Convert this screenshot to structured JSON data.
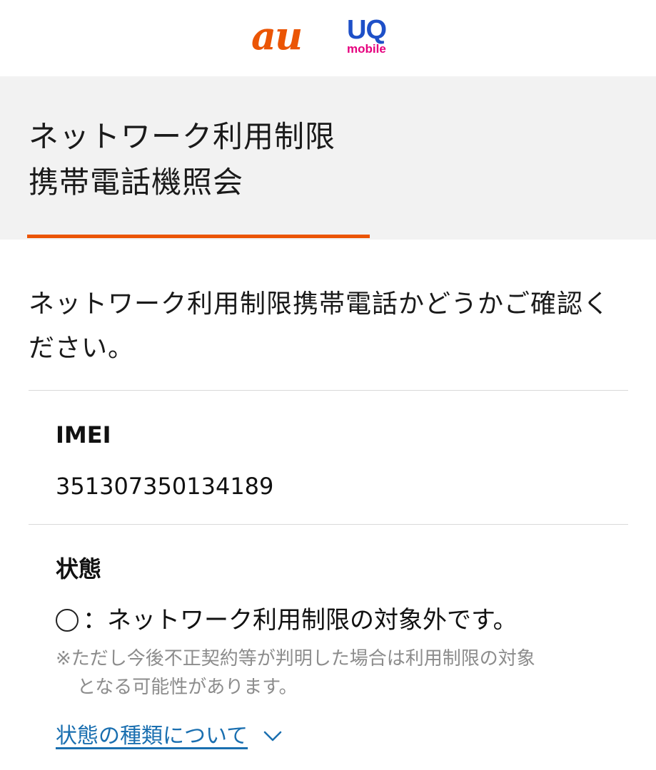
{
  "header": {
    "au_logo_text": "au",
    "uq_logo_text": "UQ",
    "uq_logo_sub": "mobile"
  },
  "page": {
    "title_line1": "ネットワーク利用制限",
    "title_line2": "携帯電話機照会",
    "intro": "ネットワーク利用制限携帯電話かどうかご確認ください。"
  },
  "imei": {
    "label": "IMEI",
    "value": "351307350134189"
  },
  "status": {
    "label": "状態",
    "symbol": "○",
    "text": "：ネットワーク利用制限の対象外です。",
    "note_line1": "※ただし今後不正契約等が判明した場合は利用制限の対象",
    "note_line2": "となる可能性があります。",
    "link_label": "状態の種類について"
  },
  "colors": {
    "au_orange": "#eb5505",
    "uq_blue": "#1e50c8",
    "uq_pink": "#e6007e",
    "link_blue": "#1a6fb0",
    "band_gray": "#f2f2f2"
  },
  "icons": {
    "status_symbol": "circle-icon",
    "link_toggle": "chevron-down-icon"
  }
}
